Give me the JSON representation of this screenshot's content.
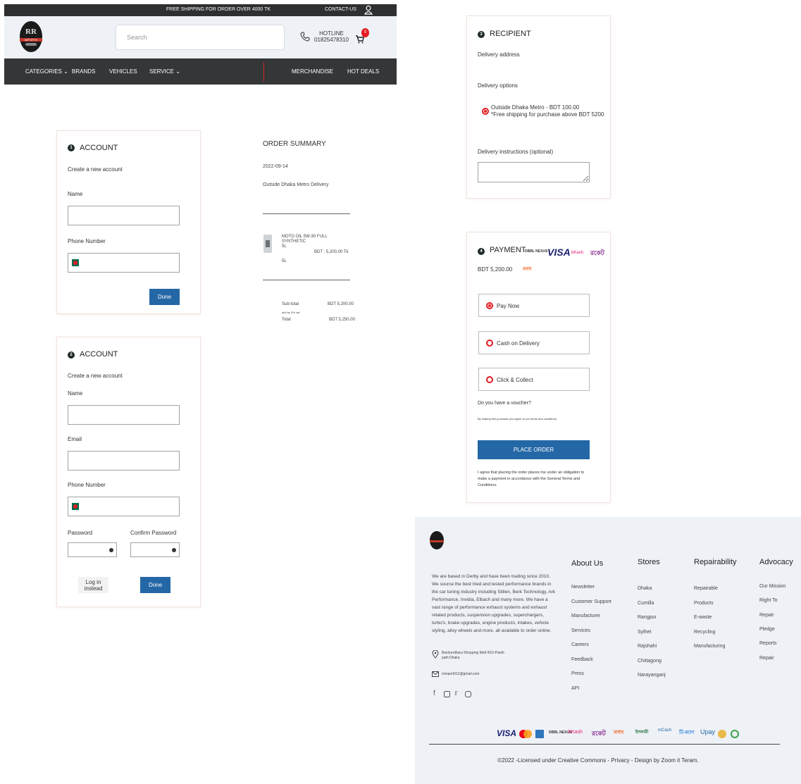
{
  "header": {
    "topbar_promo": "FREE SHIPPING FOR ORDER OVER 4000 TK",
    "contact": "CONTACT-US",
    "logo_text": "RR",
    "logo_sub": "IMPORTS",
    "search_placeholder": "Search",
    "hotline_label": "HOTLINE",
    "hotline_number": "01825478310",
    "cart_count": "0",
    "nav": {
      "categories": "CATEGORIES",
      "brands": "BRANDS",
      "vehicles": "VEHICLES",
      "service": "SERVICE",
      "merchandise": "MERCHANDISE",
      "hot_deals": "HOT DEALS"
    }
  },
  "account_login": {
    "step": "1",
    "title": "ACCOUNT",
    "subtitle": "Create a new account",
    "name_label": "Name",
    "name_value": "",
    "phone_label": "Phone Number",
    "phone_value": "",
    "done_label": "Done"
  },
  "account_register": {
    "step": "2",
    "title": "ACCOUNT",
    "subtitle": "Create a new account",
    "name_label": "Name",
    "email_label": "Email",
    "phone_label": "Phone Number",
    "password_label": "Password",
    "confirm_password_label": "Confirm Password",
    "login_instead_label": "Log in instead",
    "done_label": "Done"
  },
  "order_summary": {
    "title": "ORDER SUMMARY",
    "date": "2022-09-14",
    "delivery": "Outside Dhaka Metro Delivery",
    "product_name_1": "MOTO OIL 5W-30 FULL",
    "product_name_2": "SYNTHETIC",
    "product_size": "5L",
    "product_price": "BDT : 5,200.00 Tk",
    "product_qty": "5L",
    "subtotal_label": "Sub-total",
    "subtotal_value": "BDT 5,200.00",
    "vat_label": "add by 5% vat",
    "total_label": "Total",
    "total_value": "BDT 5,250.00"
  },
  "recipient": {
    "step": "3",
    "title": "RECIPIENT",
    "delivery_address_label": "Delivery address",
    "delivery_options_label": "Delivery options",
    "option_title": "Outside Dhaka Metro - BDT 100.00",
    "option_note": "*Free shipping for purchase above BDT 5200",
    "instructions_label": "Delivery instructions (optional)"
  },
  "payment": {
    "step": "4",
    "title": "PAYMENT",
    "amount": "BDT 5,200.00",
    "logo_visa": "VISA",
    "logo_bkash": "bKash",
    "logo_dbbl": "DBBL NEXUS",
    "logo_rocket": "রকেট",
    "logo_nagad": "নগদ",
    "options": [
      {
        "label": "Pay Now",
        "selected": true
      },
      {
        "label": "Cash on Delivery",
        "selected": false
      },
      {
        "label": "Click & Collect",
        "selected": false
      }
    ],
    "voucher_label": "Do you have a voucher?",
    "terms_note": "By making this purchase you agree to our terms and conditions.",
    "place_order_label": "PLACE ORDER",
    "agreement": "I agree that placing the order places me under an obligation to make a payment in accordance with the General Terms and Conditions."
  },
  "footer": {
    "about_text": "We are based in Derby and have been trading since 2010. We source the best tried and tested performance brands in the car tuning industry including Stillen, Berk Technology, Ark Performance, Invidia, Elbach and many more. We have a vast range of performance exhaust systems and exhaust related products, suspension upgrades, superchargers, turbo's, brake upgrades, engine products, intakes, vehicle styling, alloy wheels and more, all available to order online.",
    "address": "Bashundhara Shopping Mall 4/10-Panth path Dhaka",
    "email": "rrimport012@gmail.com",
    "columns": {
      "about": {
        "title": "About Us",
        "links": [
          "Newsletter",
          "Customer Support",
          "Manufacturer",
          "Services",
          "Careers",
          "Feedback",
          "Press",
          "API"
        ]
      },
      "stores": {
        "title": "Stores",
        "links": [
          "Dhaka",
          "Cumilla",
          "Rangpur",
          "Sylhet",
          "Rajshahi",
          "Chittagong",
          "Narayanganj"
        ]
      },
      "repairability": {
        "title": "Repairability",
        "links": [
          "Repairable",
          "Products",
          "E-waste",
          "Recycling",
          "Manufacturing"
        ]
      },
      "advocacy": {
        "title": "Advocacy",
        "links": [
          "Our Mission",
          "Right To",
          "Repair",
          "Pledge",
          "Reports",
          "Repair"
        ]
      }
    },
    "payment_logos": {
      "visa": "VISA",
      "dbbl": "DBBL NEXUS",
      "bkash": "bKash",
      "rocket": "রকেট",
      "nagad": "নগদ",
      "islami": "ইসলামী",
      "mcash": "mCash",
      "tcash": "টি-ক্যাশ",
      "upay": "Upay"
    },
    "copyright": "©2022 -Licensed under Creative Commons - Privacy - Design by Zoom it Teram."
  }
}
